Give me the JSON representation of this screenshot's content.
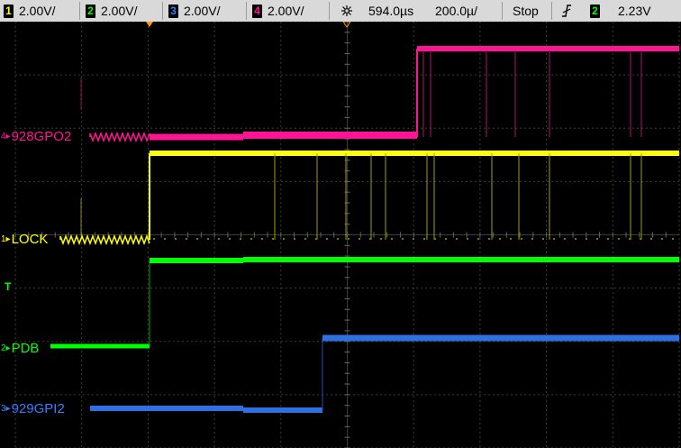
{
  "status_bar": {
    "ch1": {
      "number": "1",
      "scale": "2.00V/",
      "color": "#ffff00"
    },
    "ch2": {
      "number": "2",
      "scale": "2.00V/",
      "color": "#00ff00"
    },
    "ch3": {
      "number": "3",
      "scale": "2.00V/",
      "color": "#3a7dff"
    },
    "ch4": {
      "number": "4",
      "scale": "2.00V/",
      "color": "#ff1493"
    },
    "horizontal_position": "594.0µs",
    "timebase": "200.0µ/",
    "run_state": "Stop",
    "trigger_slope_icon": "rising-edge-icon",
    "trigger_channel": "2",
    "trigger_level": "2.23V"
  },
  "traces": [
    {
      "label": "928GPO2",
      "channel": "4",
      "color": "#ff1493"
    },
    {
      "label": "LOCK",
      "channel": "1",
      "color": "#ffff00"
    },
    {
      "label": "PDB",
      "channel": "2",
      "color": "#00ff00"
    },
    {
      "label": "929GPI2",
      "channel": "3",
      "color": "#2f6fe0"
    }
  ],
  "trigger_marker": {
    "label": "T",
    "color": "#00ff00"
  },
  "colors": {
    "grid": "#3c3c3c",
    "background": "#000000",
    "statusbar": "#d9d9d9",
    "marker": "#ff9900"
  }
}
